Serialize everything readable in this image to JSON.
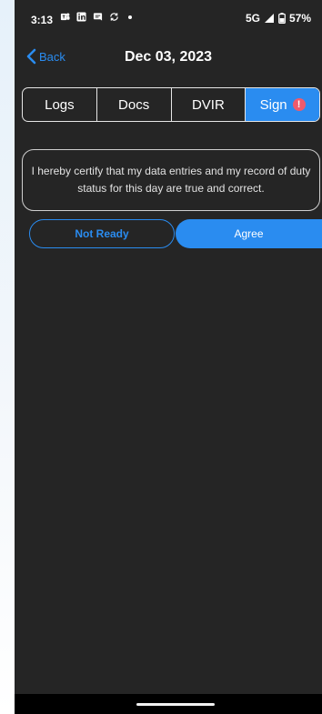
{
  "status_bar": {
    "time": "3:13",
    "network": "5G",
    "battery": "57%",
    "icons": [
      "teams-icon",
      "linkedin-icon",
      "message-icon",
      "sync-icon",
      "notification-dot"
    ]
  },
  "nav": {
    "back_label": "Back",
    "title": "Dec 03, 2023"
  },
  "tabs": [
    {
      "label": "Logs",
      "active": false
    },
    {
      "label": "Docs",
      "active": false
    },
    {
      "label": "DVIR",
      "active": false
    },
    {
      "label": "Sign",
      "active": true,
      "badge": "!"
    }
  ],
  "certification": {
    "text": "I hereby certify that my data entries and my record of duty status for this day are true and correct."
  },
  "actions": {
    "not_ready_label": "Not Ready",
    "agree_label": "Agree"
  },
  "colors": {
    "accent": "#2a8cf0",
    "background": "#252525",
    "badge": "#ef5a6b",
    "text": "#ffffff"
  }
}
